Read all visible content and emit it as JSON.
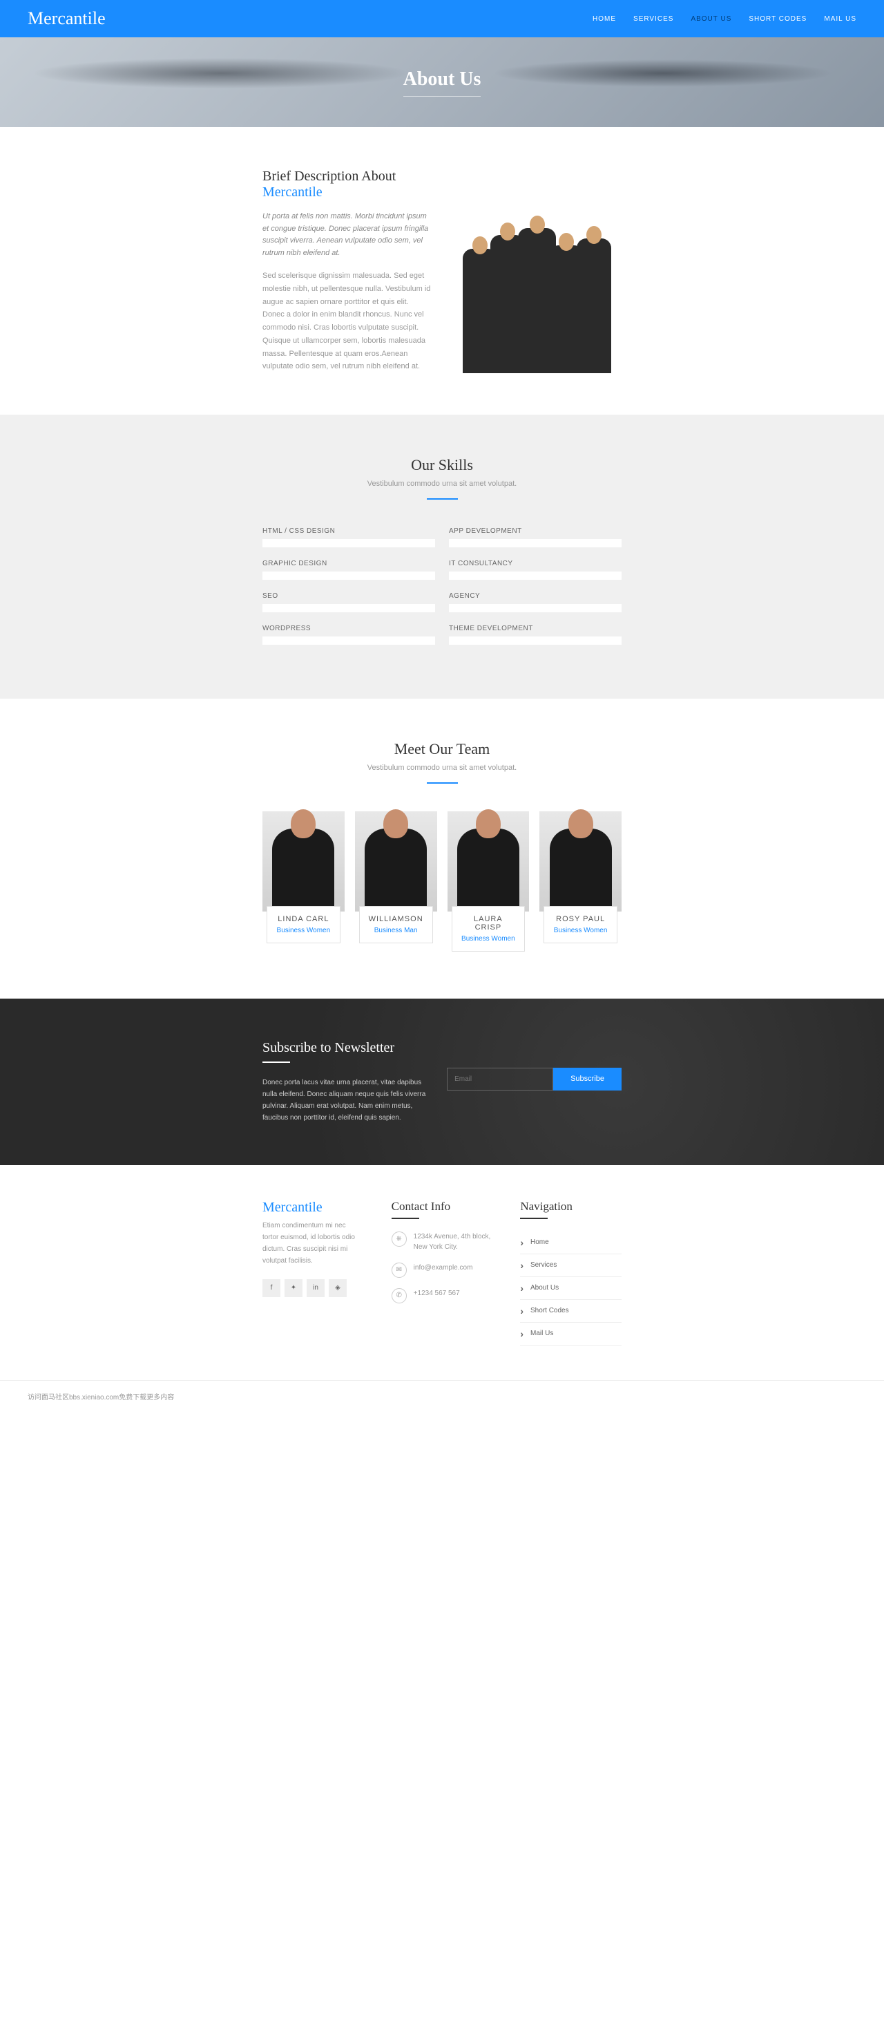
{
  "brand": "Mercantile",
  "nav": {
    "home": "HOME",
    "services": "SERVICES",
    "about": "ABOUT US",
    "codes": "SHORT CODES",
    "mail": "MAIL US"
  },
  "banner": {
    "title": "About Us"
  },
  "about": {
    "heading": "Brief Description About ",
    "heading_brand": "Mercantile",
    "em": "Ut porta at felis non mattis. Morbi tincidunt ipsum et congue tristique. Donec placerat ipsum fringilla suscipit viverra. Aenean vulputate odio sem, vel rutrum nibh eleifend at.",
    "para": "Sed scelerisque dignissim malesuada. Sed eget molestie nibh, ut pellentesque nulla. Vestibulum id augue ac sapien ornare porttitor et quis elit. Donec a dolor in enim blandit rhoncus. Nunc vel commodo nisi. Cras lobortis vulputate suscipit. Quisque ut ullamcorper sem, lobortis malesuada massa. Pellentesque at quam eros.Aenean vulputate odio sem, vel rutrum nibh eleifend at."
  },
  "skills": {
    "title": "Our Skills",
    "sub": "Vestibulum commodo urna sit amet volutpat.",
    "left": [
      "HTML / CSS DESIGN",
      "GRAPHIC DESIGN",
      "SEO",
      "WORDPRESS"
    ],
    "right": [
      "APP DEVELOPMENT",
      "IT CONSULTANCY",
      "AGENCY",
      "THEME DEVELOPMENT"
    ]
  },
  "team": {
    "title": "Meet Our Team",
    "sub": "Vestibulum commodo urna sit amet volutpat.",
    "members": [
      {
        "name": "LINDA CARL",
        "role": "Business Women"
      },
      {
        "name": "WILLIAMSON",
        "role": "Business Man"
      },
      {
        "name": "LAURA CRISP",
        "role": "Business Women"
      },
      {
        "name": "ROSY PAUL",
        "role": "Business Women"
      }
    ]
  },
  "subscribe": {
    "title": "Subscribe to Newsletter",
    "text": "Donec porta lacus vitae urna placerat, vitae dapibus nulla eleifend. Donec aliquam neque quis felis viverra pulvinar. Aliquam erat volutpat. Nam enim metus, faucibus non porttitor id, eleifend quis sapien.",
    "placeholder": "Email",
    "button": "Subscribe"
  },
  "footer": {
    "brand": "Mercantile",
    "brand_text": "Etiam condimentum mi nec tortor euismod, id lobortis odio dictum. Cras suscipit nisi mi volutpat facilisis.",
    "contact": {
      "title": "Contact Info",
      "addr": "1234k Avenue, 4th block, New York City.",
      "email": "info@example.com",
      "phone": "+1234 567 567"
    },
    "navigation": {
      "title": "Navigation",
      "items": [
        "Home",
        "Services",
        "About Us",
        "Short Codes",
        "Mail Us"
      ]
    }
  },
  "bottom": "访问面马社区bbs.xieniao.com免费下载更多内容"
}
